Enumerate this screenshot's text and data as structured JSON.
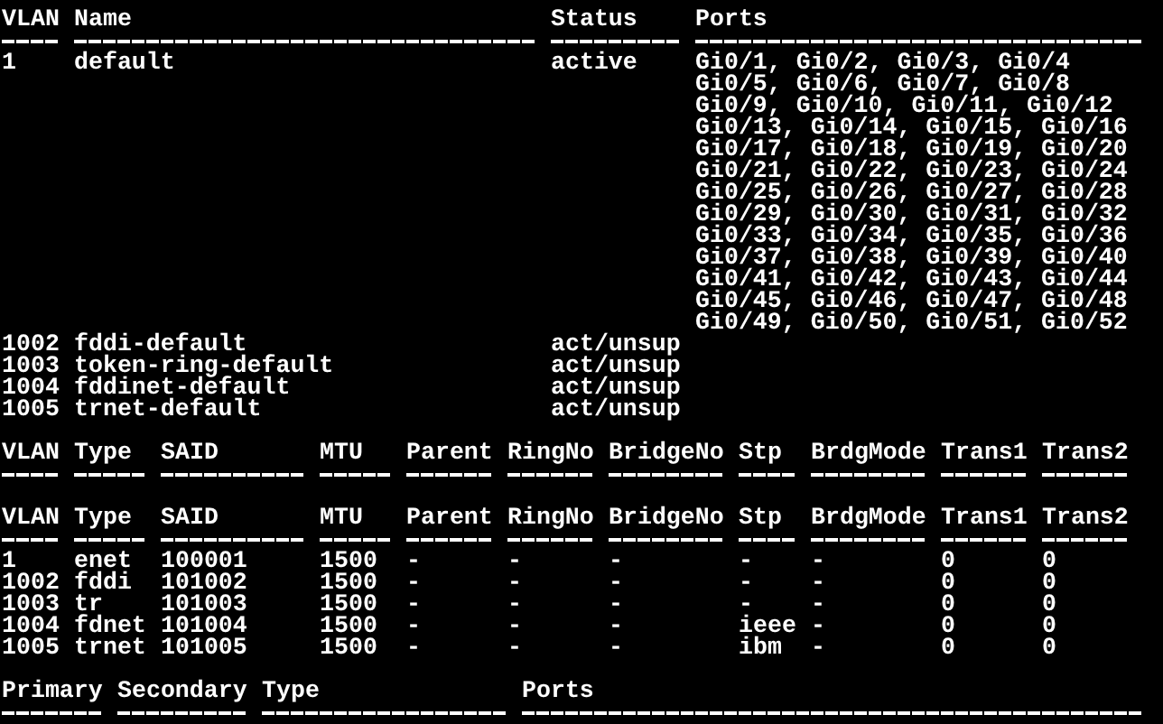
{
  "vlan_table": {
    "columns": [
      "VLAN",
      "Name",
      "Status",
      "Ports"
    ],
    "rows": [
      {
        "vlan": "1",
        "name": "default",
        "status": "active",
        "ports": [
          "Gi0/1, Gi0/2, Gi0/3, Gi0/4",
          "Gi0/5, Gi0/6, Gi0/7, Gi0/8",
          "Gi0/9, Gi0/10, Gi0/11, Gi0/12",
          "Gi0/13, Gi0/14, Gi0/15, Gi0/16",
          "Gi0/17, Gi0/18, Gi0/19, Gi0/20",
          "Gi0/21, Gi0/22, Gi0/23, Gi0/24",
          "Gi0/25, Gi0/26, Gi0/27, Gi0/28",
          "Gi0/29, Gi0/30, Gi0/31, Gi0/32",
          "Gi0/33, Gi0/34, Gi0/35, Gi0/36",
          "Gi0/37, Gi0/38, Gi0/39, Gi0/40",
          "Gi0/41, Gi0/42, Gi0/43, Gi0/44",
          "Gi0/45, Gi0/46, Gi0/47, Gi0/48",
          "Gi0/49, Gi0/50, Gi0/51, Gi0/52"
        ]
      },
      {
        "vlan": "1002",
        "name": "fddi-default",
        "status": "act/unsup"
      },
      {
        "vlan": "1003",
        "name": "token-ring-default",
        "status": "act/unsup"
      },
      {
        "vlan": "1004",
        "name": "fddinet-default",
        "status": "act/unsup"
      },
      {
        "vlan": "1005",
        "name": "trnet-default",
        "status": "act/unsup"
      }
    ]
  },
  "vlan_type_header": {
    "columns": [
      "VLAN",
      "Type",
      "SAID",
      "MTU",
      "Parent",
      "RingNo",
      "BridgeNo",
      "Stp",
      "BrdgMode",
      "Trans1",
      "Trans2"
    ]
  },
  "vlan_type_table": {
    "columns": [
      "VLAN",
      "Type",
      "SAID",
      "MTU",
      "Parent",
      "RingNo",
      "BridgeNo",
      "Stp",
      "BrdgMode",
      "Trans1",
      "Trans2"
    ],
    "rows": [
      [
        "1",
        "enet",
        "100001",
        "1500",
        "-",
        "-",
        "-",
        "-",
        "-",
        "0",
        "0"
      ],
      [
        "1002",
        "fddi",
        "101002",
        "1500",
        "-",
        "-",
        "-",
        "-",
        "-",
        "0",
        "0"
      ],
      [
        "1003",
        "tr",
        "101003",
        "1500",
        "-",
        "-",
        "-",
        "-",
        "-",
        "0",
        "0"
      ],
      [
        "1004",
        "fdnet",
        "101004",
        "1500",
        "-",
        "-",
        "-",
        "ieee",
        "-",
        "0",
        "0"
      ],
      [
        "1005",
        "trnet",
        "101005",
        "1500",
        "-",
        "-",
        "-",
        "ibm",
        "-",
        "0",
        "0"
      ]
    ]
  },
  "private_vlan_table": {
    "columns": [
      "Primary",
      "Secondary",
      "Type",
      "Ports"
    ]
  }
}
